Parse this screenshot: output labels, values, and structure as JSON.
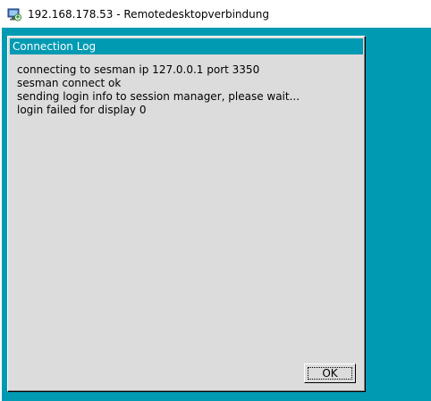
{
  "window": {
    "title": "192.168.178.53 - Remotedesktopverbindung",
    "icon": "remote-desktop-icon"
  },
  "dialog": {
    "title": "Connection Log",
    "log_lines": [
      "connecting to sesman ip 127.0.0.1 port 3350",
      "sesman connect ok",
      "sending login info to session manager, please wait...",
      "login failed for display 0"
    ],
    "ok_label": "OK"
  },
  "colors": {
    "desktop_background": "#009ab3",
    "dialog_background": "#dcdcdc",
    "dialog_titlebar": "#009ab3"
  }
}
